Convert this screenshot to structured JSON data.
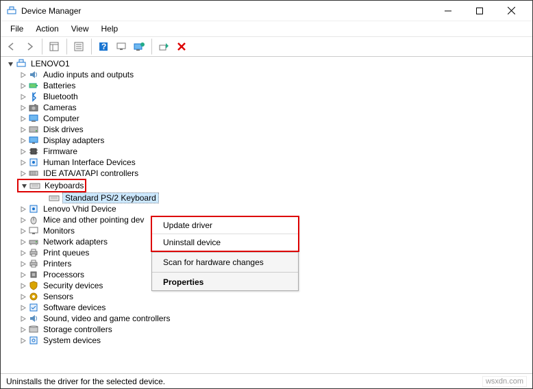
{
  "window": {
    "title": "Device Manager"
  },
  "menubar": {
    "file": "File",
    "action": "Action",
    "view": "View",
    "help": "Help"
  },
  "root": {
    "label": "LENOVO1"
  },
  "categories": [
    {
      "label": "Audio inputs and outputs",
      "icon": "speaker"
    },
    {
      "label": "Batteries",
      "icon": "battery"
    },
    {
      "label": "Bluetooth",
      "icon": "bluetooth"
    },
    {
      "label": "Cameras",
      "icon": "camera"
    },
    {
      "label": "Computer",
      "icon": "computer"
    },
    {
      "label": "Disk drives",
      "icon": "disk"
    },
    {
      "label": "Display adapters",
      "icon": "display"
    },
    {
      "label": "Firmware",
      "icon": "chip"
    },
    {
      "label": "Human Interface Devices",
      "icon": "hid"
    },
    {
      "label": "IDE ATA/ATAPI controllers",
      "icon": "ide"
    },
    {
      "label": "Keyboards",
      "icon": "keyboard",
      "expanded": true,
      "highlighted": true,
      "children": [
        {
          "label": "Standard PS/2 Keyboard",
          "icon": "keyboard",
          "selected": true
        }
      ]
    },
    {
      "label": "Lenovo Vhid Device",
      "icon": "hid"
    },
    {
      "label": "Mice and other pointing dev",
      "icon": "mouse"
    },
    {
      "label": "Monitors",
      "icon": "monitor"
    },
    {
      "label": "Network adapters",
      "icon": "network"
    },
    {
      "label": "Print queues",
      "icon": "printer"
    },
    {
      "label": "Printers",
      "icon": "printer"
    },
    {
      "label": "Processors",
      "icon": "cpu"
    },
    {
      "label": "Security devices",
      "icon": "security"
    },
    {
      "label": "Sensors",
      "icon": "sensor"
    },
    {
      "label": "Software devices",
      "icon": "software"
    },
    {
      "label": "Sound, video and game controllers",
      "icon": "speaker"
    },
    {
      "label": "Storage controllers",
      "icon": "storage"
    },
    {
      "label": "System devices",
      "icon": "system"
    }
  ],
  "context_menu": {
    "update": "Update driver",
    "uninstall": "Uninstall device",
    "scan": "Scan for hardware changes",
    "properties": "Properties"
  },
  "status": {
    "text": "Uninstalls the driver for the selected device."
  },
  "watermark": "wsxdn.com"
}
